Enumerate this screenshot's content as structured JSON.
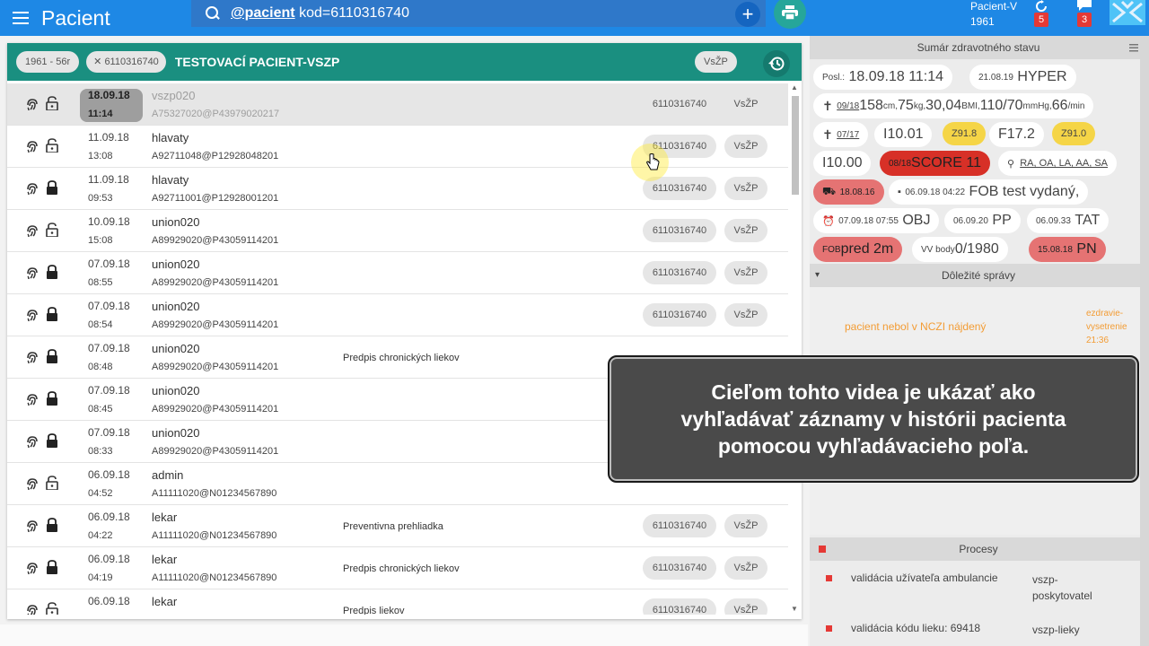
{
  "appbar": {
    "title": "Pacient",
    "search_keyword": "@pacient",
    "search_query": " kod=6110316740",
    "patient_label": "Pacient-V",
    "patient_year": "1961",
    "notif1_count": "5",
    "notif2_count": "3"
  },
  "patient": {
    "age_chip": "1961 - 56r",
    "id_chip": "6110316740",
    "name": "TESTOVACÍ PACIENT-VSZP",
    "insurer_chip": "VsŽP"
  },
  "rows": [
    {
      "date": "18.09.18",
      "time": "11:14",
      "user": "vszp020",
      "code": "A75327020@P43979020217",
      "desc": "",
      "chip1": "6110316740",
      "chip2": "VsŽP"
    },
    {
      "date": "11.09.18",
      "time": "13:08",
      "user": "hlavaty",
      "code": "A92711048@P12928048201",
      "desc": "",
      "chip1": "6110316740",
      "chip2": "VsŽP"
    },
    {
      "date": "11.09.18",
      "time": "09:53",
      "user": "hlavaty",
      "code": "A92711001@P12928001201",
      "desc": "",
      "chip1": "6110316740",
      "chip2": "VsŽP"
    },
    {
      "date": "10.09.18",
      "time": "15:08",
      "user": "union020",
      "code": "A89929020@P43059114201",
      "desc": "",
      "chip1": "6110316740",
      "chip2": "VsŽP"
    },
    {
      "date": "07.09.18",
      "time": "08:55",
      "user": "union020",
      "code": "A89929020@P43059114201",
      "desc": "",
      "chip1": "6110316740",
      "chip2": "VsŽP"
    },
    {
      "date": "07.09.18",
      "time": "08:54",
      "user": "union020",
      "code": "A89929020@P43059114201",
      "desc": "",
      "chip1": "6110316740",
      "chip2": "VsŽP"
    },
    {
      "date": "07.09.18",
      "time": "08:48",
      "user": "union020",
      "code": "A89929020@P43059114201",
      "desc": "Predpis chronických liekov",
      "chip1": "",
      "chip2": ""
    },
    {
      "date": "07.09.18",
      "time": "08:45",
      "user": "union020",
      "code": "A89929020@P43059114201",
      "desc": "",
      "chip1": "",
      "chip2": ""
    },
    {
      "date": "07.09.18",
      "time": "08:33",
      "user": "union020",
      "code": "A89929020@P43059114201",
      "desc": "",
      "chip1": "",
      "chip2": ""
    },
    {
      "date": "06.09.18",
      "time": "04:52",
      "user": "admin",
      "code": "A11111020@N01234567890",
      "desc": "",
      "chip1": "",
      "chip2": ""
    },
    {
      "date": "06.09.18",
      "time": "04:22",
      "user": "lekar",
      "code": "A11111020@N01234567890",
      "desc": "Preventivna prehliadka",
      "chip1": "6110316740",
      "chip2": "VsŽP"
    },
    {
      "date": "06.09.18",
      "time": "04:19",
      "user": "lekar",
      "code": "A11111020@N01234567890",
      "desc": "Predpis chronických liekov",
      "chip1": "6110316740",
      "chip2": "VsŽP"
    },
    {
      "date": "06.09.18",
      "time": "",
      "user": "lekar",
      "code": "",
      "desc": "Predpis liekov",
      "chip1": "6110316740",
      "chip2": "VsŽP"
    }
  ],
  "summary": {
    "title": "Sumár zdravotného stavu",
    "posl_label": "Posl.:",
    "posl_value": "18.09.18 11:14",
    "hyper_date": "21.08.19",
    "hyper_value": "HYPER",
    "vitals_date": "09/18",
    "vitals_height": "158",
    "vitals_height_unit": "cm,",
    "vitals_weight": "75",
    "vitals_weight_unit": "kg,",
    "vitals_bmi": "30,04",
    "vitals_bmi_unit": "BMI,",
    "vitals_bp": "110/70",
    "vitals_bp_unit": "mmHg,",
    "vitals_pulse": "66",
    "vitals_pulse_unit": "/min",
    "diag_date": "07/17",
    "diag1": "I10.01",
    "diag2": "Z91.8",
    "diag3": "F17.2",
    "diag4": "Z91.0",
    "diag5": "I10.00",
    "score_date": "08/18",
    "score_value": "SCORE 11",
    "allergy": "RA, OA, LA, AA, SA",
    "stay_date": "18.08.16",
    "fob_msg_time": "06.09.18 04:22",
    "fob_msg": "FOB test vydaný,",
    "obj_time": "07.09.18 07:55",
    "obj": "OBJ",
    "pp_date": "06.09.20",
    "pp": "PP",
    "tat_date": "06.09.33",
    "tat": "TAT",
    "fob_prefix": "FOB",
    "fob_value": "pred 2m",
    "vv_label": "VV body",
    "vv_value": "0/1980",
    "pn_date": "15.08.18",
    "pn": "PN"
  },
  "messages": {
    "title": "Dôležité správy",
    "text": "pacient nebol v NCZI nájdený",
    "meta1": "ezdravie-",
    "meta2": "vysetrenie",
    "meta3": "21:36"
  },
  "processes": {
    "title": "Procesy",
    "items": [
      {
        "name": "validácia užívateľa ambulancie",
        "who1": "vszp-",
        "who2": "poskytovatel"
      },
      {
        "name": "validácia kódu lieku: 69418",
        "who1": "vszp-lieky",
        "who2": ""
      }
    ]
  },
  "caption": {
    "line1": "Cieľom tohto videa je ukázať ako",
    "line2": "vyhľadávať záznamy v histórii pacienta",
    "line3": "pomocou vyhľadávacieho poľa."
  },
  "colors": {
    "appbar": "#1e88e5",
    "patient_header": "#1a8f80",
    "badge_red": "#e53935",
    "pill_yellow": "#f5d547",
    "pill_red": "#d73027",
    "message_orange": "#f39c34"
  }
}
